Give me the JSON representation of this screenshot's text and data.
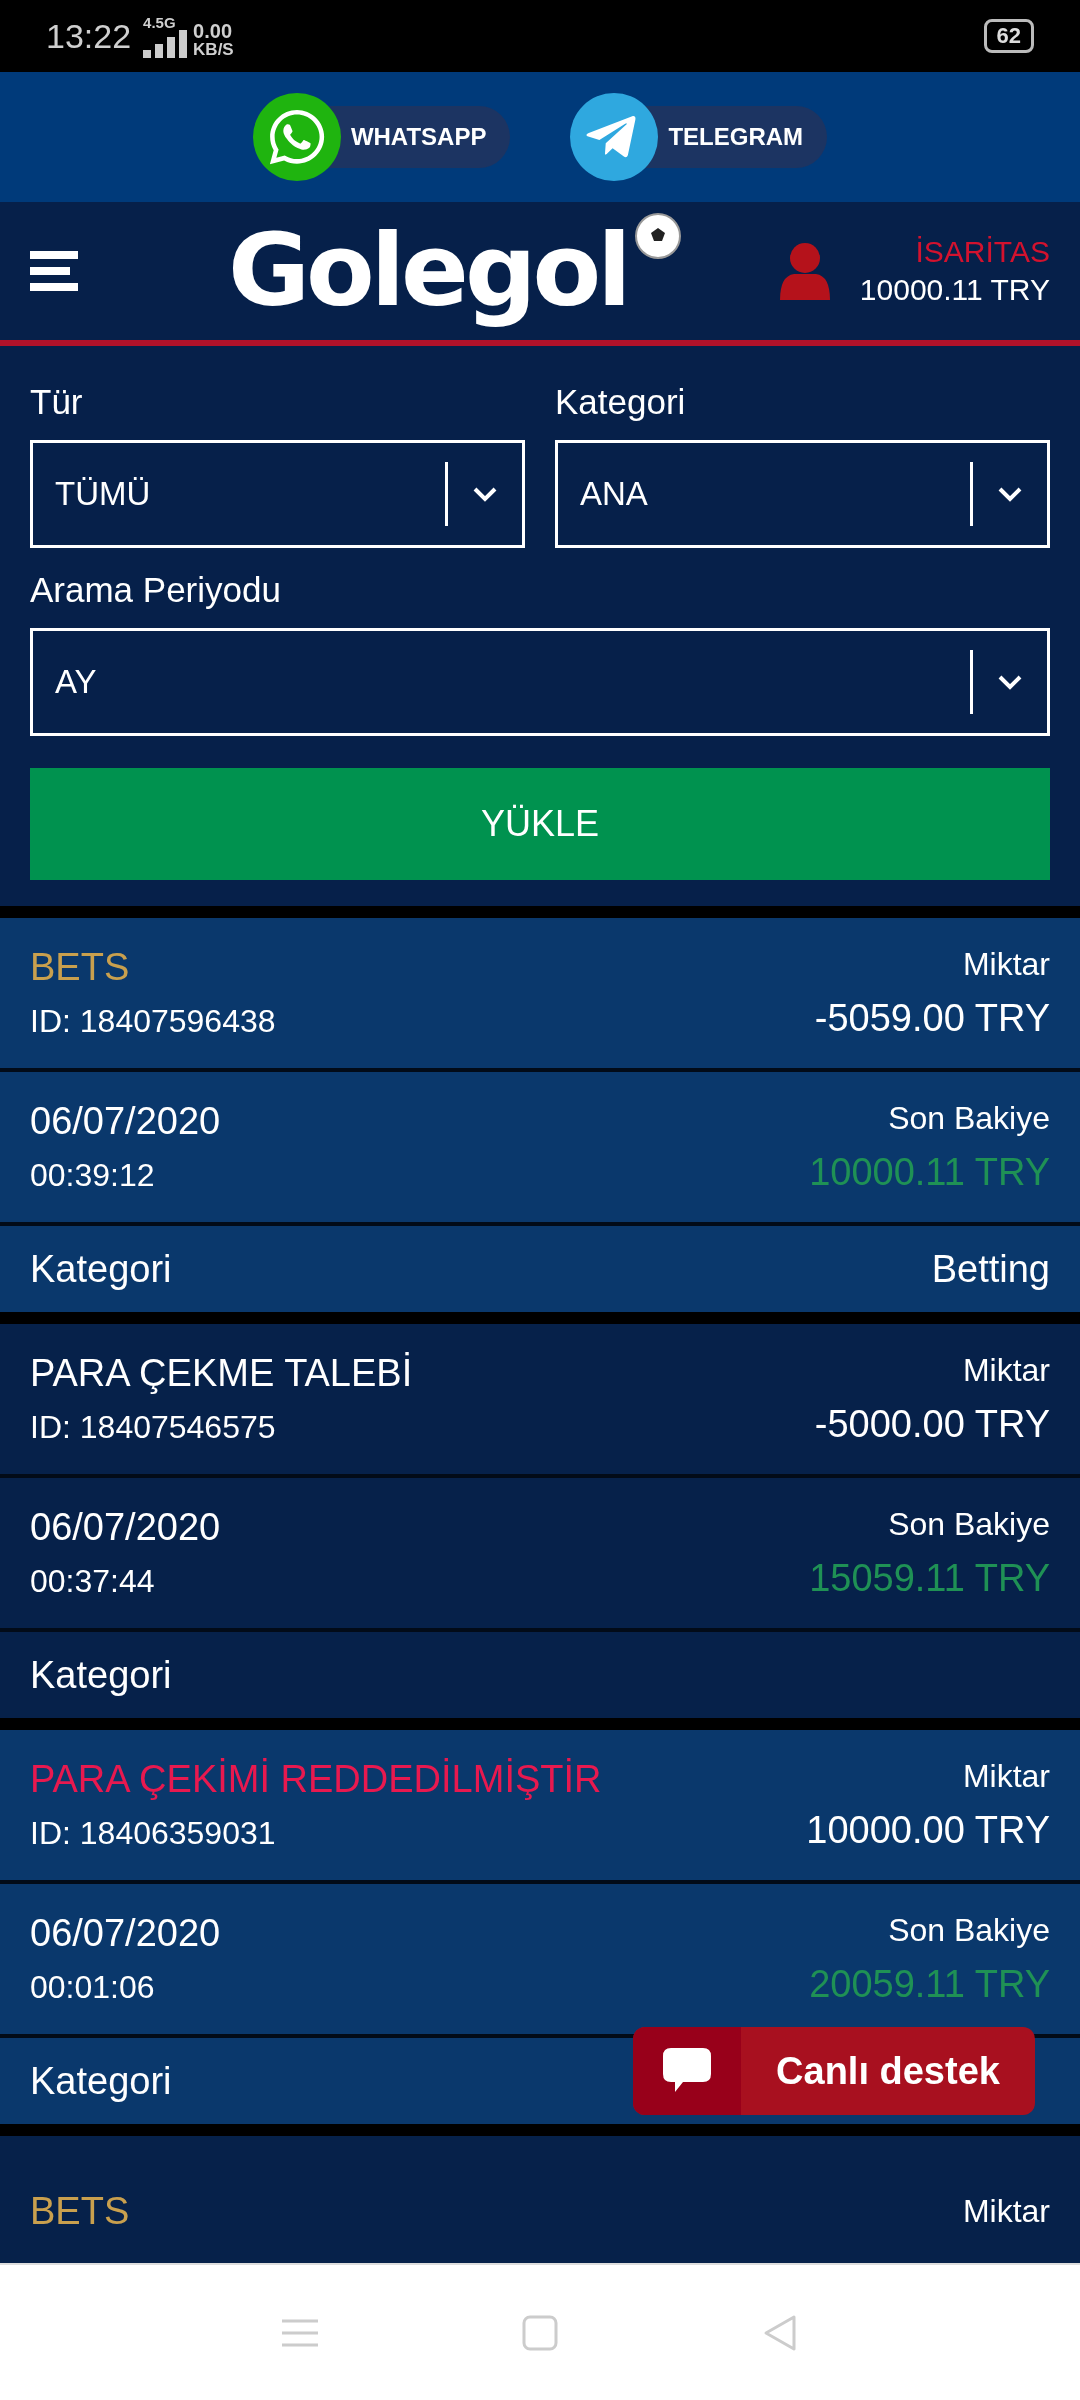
{
  "status_bar": {
    "time": "13:22",
    "network": "4.5G",
    "speed": "0.00",
    "speed_unit": "KB/S",
    "battery": "62"
  },
  "social": [
    {
      "kind": "whatsapp",
      "label": "WHATSAPP"
    },
    {
      "kind": "telegram",
      "label": "TELEGRAM"
    }
  ],
  "header": {
    "logo": "Golegol",
    "username": "İSARİTAS",
    "balance": "10000.11 TRY"
  },
  "filters": [
    {
      "label": "Tür",
      "value": "TÜMÜ"
    },
    {
      "label": "Kategori",
      "value": "ANA"
    },
    {
      "label": "Arama Periyodu",
      "value": "AY"
    }
  ],
  "load_button": "YÜKLE",
  "transactions": [
    {
      "title": "BETS",
      "color": "#c9a04e",
      "id": "ID: 18407596438",
      "amount_label": "Miktar",
      "amount": "-5059.00 TRY",
      "date": "06/07/2020",
      "time": "00:39:12",
      "balance_label": "Son Bakiye",
      "balance": "10000.11 TRY",
      "category_label": "Kategori",
      "category": "Betting"
    },
    {
      "title": "PARA ÇEKME TALEBİ",
      "color": "#ffffff",
      "id": "ID: 18407546575",
      "amount_label": "Miktar",
      "amount": "-5000.00 TRY",
      "date": "06/07/2020",
      "time": "00:37:44",
      "balance_label": "Son Bakiye",
      "balance": "15059.11 TRY",
      "category_label": "Kategori"
    },
    {
      "title": "PARA ÇEKİMİ REDDEDİLMİŞTİR",
      "color": "#e8194f",
      "id": "ID: 18406359031",
      "amount_label": "Miktar",
      "amount": "10000.00 TRY",
      "date": "06/07/2020",
      "time": "00:01:06",
      "balance_label": "Son Bakiye",
      "balance": "20059.11 TRY",
      "category_label": "Kategori"
    },
    {
      "title": "BETS",
      "color": "#c9a04e",
      "amount_label": "Miktar"
    }
  ],
  "chat_button": "Canlı destek"
}
